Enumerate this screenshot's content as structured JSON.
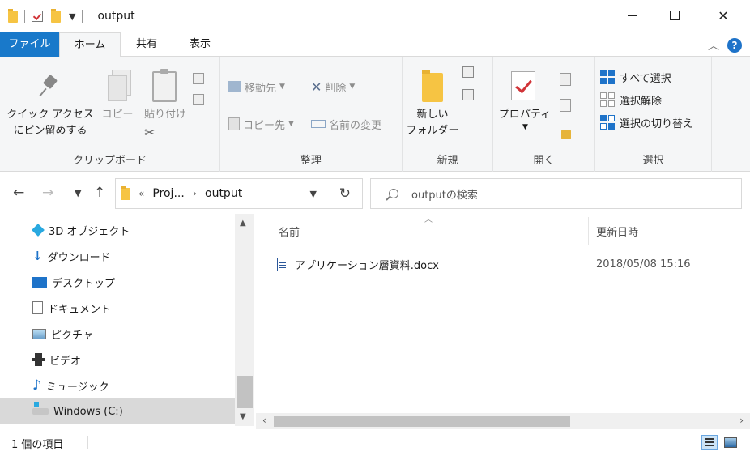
{
  "window": {
    "title": "output",
    "minimize": "—",
    "close": "✕"
  },
  "tabs": {
    "file": "ファイル",
    "home": "ホーム",
    "share": "共有",
    "view": "表示",
    "collapse": "^",
    "help": "?"
  },
  "ribbon": {
    "clipboard": {
      "label": "クリップボード",
      "pin_line1": "クイック アクセス",
      "pin_line2": "にピン留めする",
      "copy": "コピー",
      "paste": "貼り付け"
    },
    "organize": {
      "label": "整理",
      "move_to": "移動先",
      "copy_to": "コピー先",
      "delete": "削除",
      "rename": "名前の変更"
    },
    "new": {
      "label": "新規",
      "new_folder_line1": "新しい",
      "new_folder_line2": "フォルダー"
    },
    "open": {
      "label": "開く",
      "properties": "プロパティ"
    },
    "select": {
      "label": "選択",
      "select_all": "すべて選択",
      "select_none": "選択解除",
      "invert": "選択の切り替え"
    }
  },
  "address": {
    "overflow": "«",
    "crumbs": [
      "Proj...",
      "output"
    ],
    "separator": "›",
    "search_placeholder": "outputの検索"
  },
  "nav_pane": {
    "items": [
      {
        "label": "3D オブジェクト",
        "icon": "cube-icon"
      },
      {
        "label": "ダウンロード",
        "icon": "download-icon"
      },
      {
        "label": "デスクトップ",
        "icon": "desktop-icon"
      },
      {
        "label": "ドキュメント",
        "icon": "documents-icon"
      },
      {
        "label": "ピクチャ",
        "icon": "pictures-icon"
      },
      {
        "label": "ビデオ",
        "icon": "videos-icon"
      },
      {
        "label": "ミュージック",
        "icon": "music-icon"
      },
      {
        "label": "Windows (C:)",
        "icon": "drive-icon"
      }
    ],
    "selected_index": 7
  },
  "file_list": {
    "columns": {
      "name": "名前",
      "date": "更新日時"
    },
    "rows": [
      {
        "name": "アプリケーション層資料.docx",
        "date": "2018/05/08 15:16"
      }
    ]
  },
  "status": {
    "item_count": "1 個の項目"
  },
  "colors": {
    "accent": "#1979ca",
    "selection": "#d9d9d9"
  }
}
